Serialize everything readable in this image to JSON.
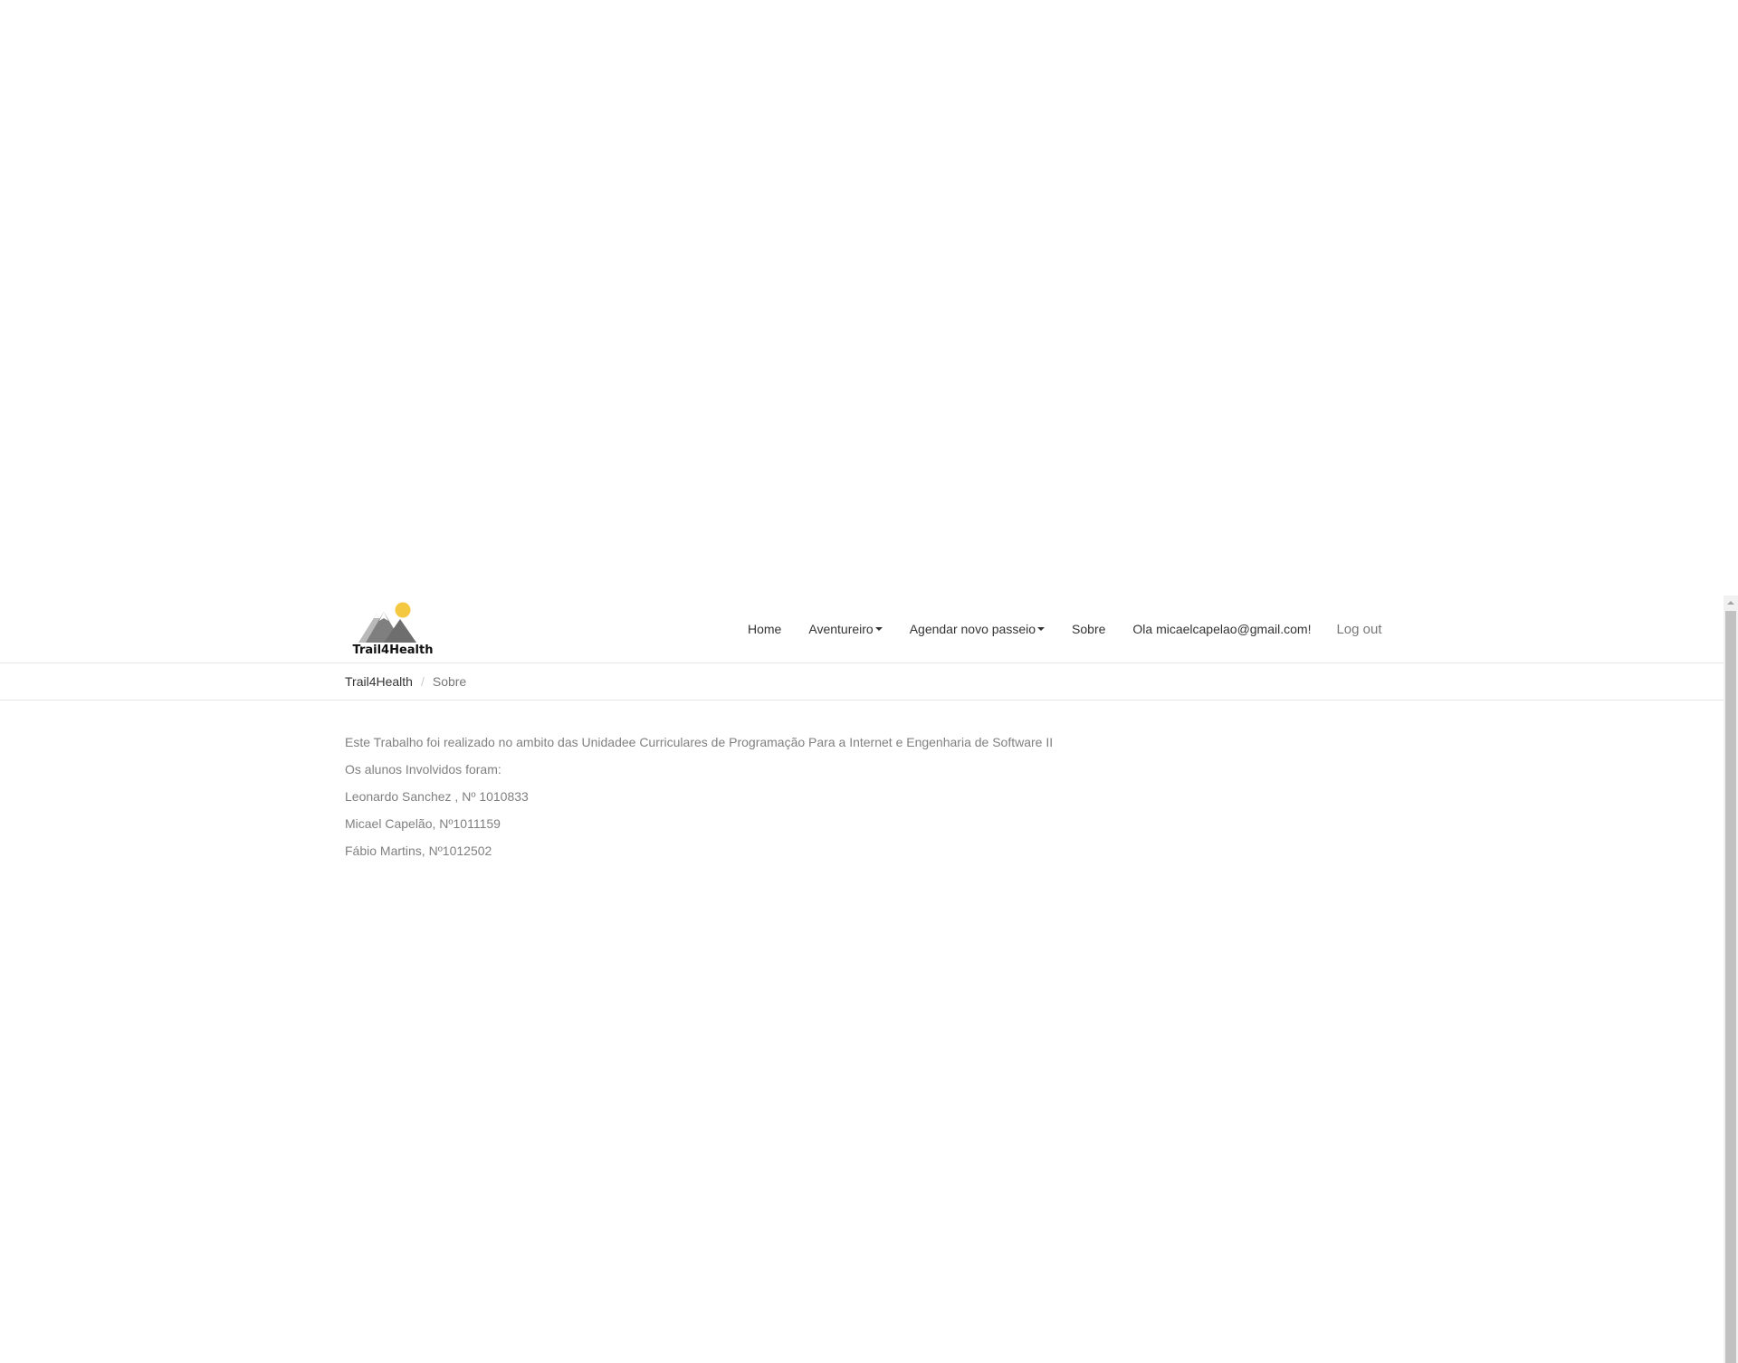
{
  "logo": {
    "text": "Trail4Health",
    "sun_color": "#f5c842",
    "mountain_color": "#8a8a8a"
  },
  "nav": {
    "items": [
      {
        "label": "Home",
        "has_dropdown": false
      },
      {
        "label": "Aventureiro",
        "has_dropdown": true
      },
      {
        "label": "Agendar novo passeio",
        "has_dropdown": true
      },
      {
        "label": "Sobre",
        "has_dropdown": false
      },
      {
        "label": "Ola micaelcapelao@gmail.com!",
        "has_dropdown": false
      }
    ],
    "logout_label": "Log out"
  },
  "breadcrumb": {
    "home": "Trail4Health",
    "separator": "/",
    "current": "Sobre"
  },
  "content": {
    "paragraphs": [
      "Este Trabalho foi realizado no ambito das Unidadee Curriculares de Programação Para a Internet e Engenharia de Software II",
      "Os alunos Involvidos foram:",
      "Leonardo Sanchez , Nº 1010833",
      "Micael Capelão, Nº1011159",
      "Fábio Martins, Nº1012502"
    ]
  }
}
